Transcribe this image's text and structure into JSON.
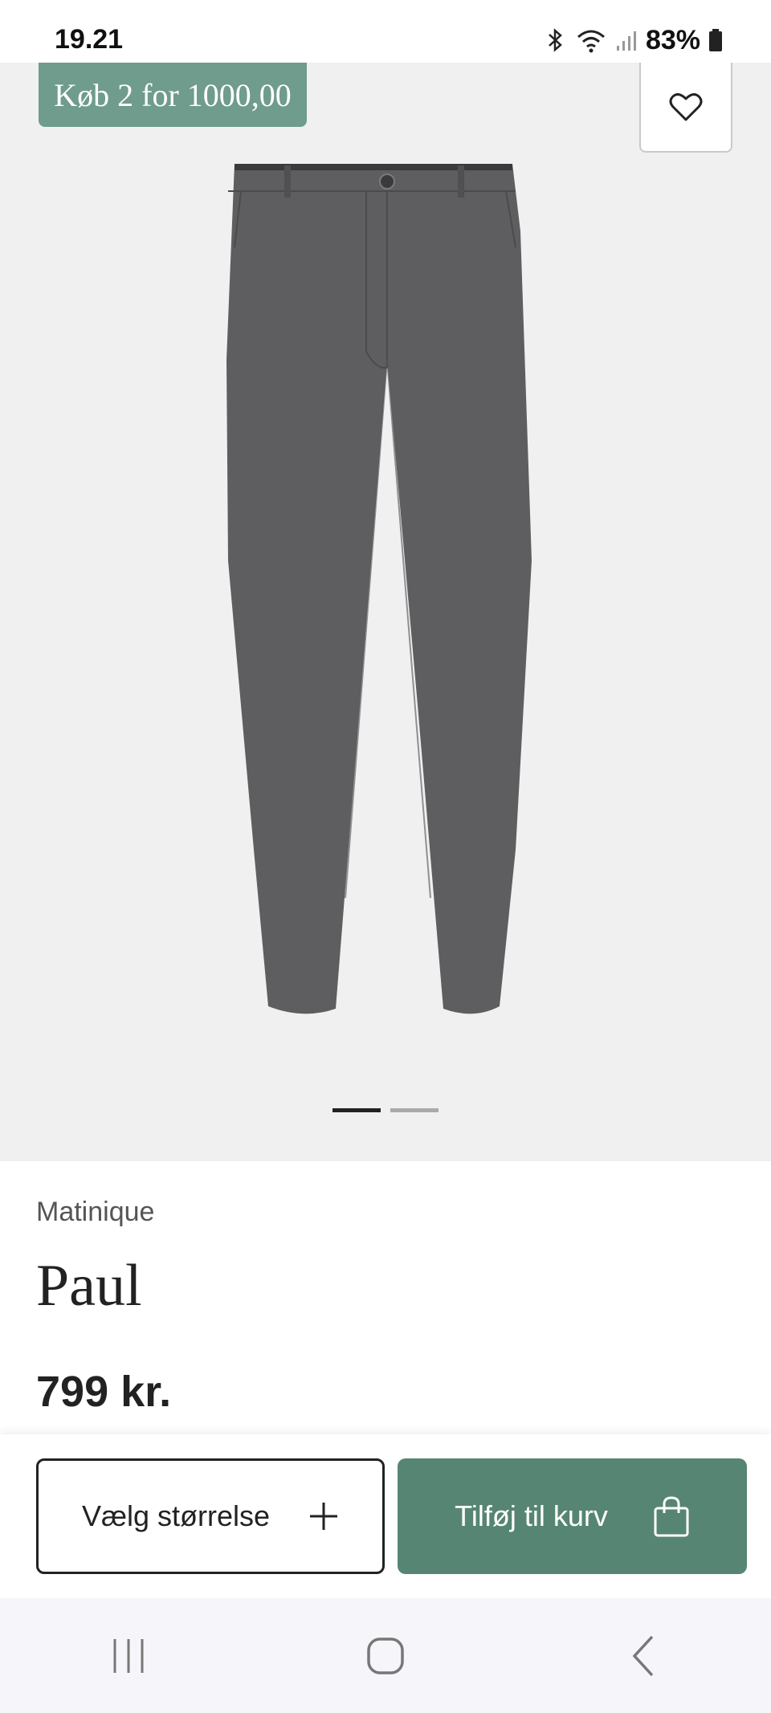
{
  "status_bar": {
    "time": "19.21",
    "battery": "83%",
    "icons": [
      "bluetooth-icon",
      "wifi-icon",
      "signal-icon",
      "battery-icon"
    ]
  },
  "gallery": {
    "promo_badge": "Køb 2 for 1000,00",
    "favorite_icon": "heart-icon",
    "image_count": 2,
    "active_image": 1
  },
  "product": {
    "brand": "Matinique",
    "name": "Paul",
    "price": "799 kr."
  },
  "actions": {
    "size_label": "Vælg størrelse",
    "size_icon": "plus-icon",
    "cart_label": "Tilføj til kurv",
    "cart_icon": "shopping-bag-icon"
  },
  "nav": {
    "icons": [
      "recent-apps-icon",
      "home-icon",
      "back-icon"
    ]
  },
  "colors": {
    "accent": "#568573",
    "promo": "#6f9c8c",
    "gallery_bg": "#f0f0f0",
    "pants": "#5d5d60"
  }
}
